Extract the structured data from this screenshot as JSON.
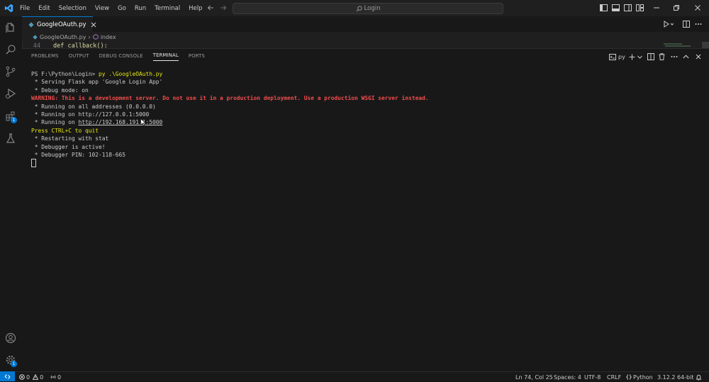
{
  "menu": [
    "File",
    "Edit",
    "Selection",
    "View",
    "Go",
    "Run",
    "Terminal",
    "Help"
  ],
  "search": {
    "label": "Login"
  },
  "activity_badges": {
    "extensions": "1",
    "settings": "1"
  },
  "tab": {
    "label": "GoogleOAuth.py"
  },
  "breadcrumb": {
    "file": "GoogleOAuth.py",
    "symbol": "index"
  },
  "code": {
    "line_number": "44",
    "text": "def callback():"
  },
  "panel_tabs": [
    "PROBLEMS",
    "OUTPUT",
    "DEBUG CONSOLE",
    "TERMINAL",
    "PORTS"
  ],
  "terminal_profile": "py",
  "terminal": {
    "prompt": "PS F:\\Python\\Login> ",
    "command": "py .\\GoogleOAuth.py",
    "line1": " * Serving Flask app 'Google Login App'",
    "line2": " * Debug mode: on",
    "warning": "WARNING: This is a development server. Do not use it in a production deployment. Use a production WSGI server instead.",
    "line3": " * Running on all addresses (0.0.0.0)",
    "line4": " * Running on http://127.0.0.1:5000",
    "line5_prefix": " * Running on ",
    "line5_url": "http://192.168.191.1:5000",
    "quit": "Press CTRL+C to quit",
    "line6": " * Restarting with stat",
    "line7": " * Debugger is active!",
    "line8": " * Debugger PIN: 102-118-665"
  },
  "status": {
    "errors": "0",
    "warnings": "0",
    "ports": "0",
    "position": "Ln 74, Col 25",
    "spaces": "Spaces: 4",
    "encoding": "UTF-8",
    "eol": "CRLF",
    "language": "Python",
    "interpreter": "3.12.2 64-bit"
  },
  "colors": {
    "accent": "#0078d4",
    "warning": "#f14c4c",
    "highlight": "#e5e510"
  }
}
